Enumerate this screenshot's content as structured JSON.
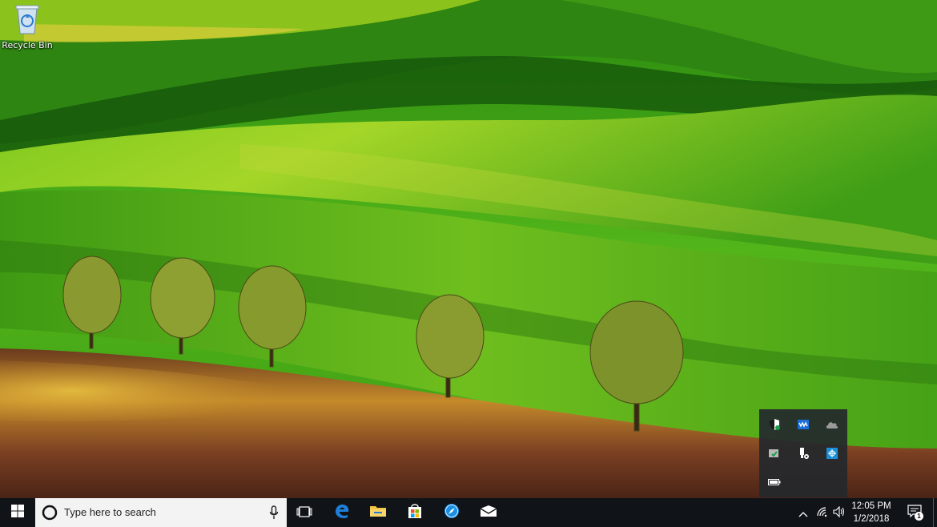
{
  "desktop": {
    "icons": [
      {
        "label": "Recycle Bin",
        "icon": "recycle-bin-icon"
      }
    ]
  },
  "taskbar": {
    "start_icon": "windows-logo-icon",
    "search": {
      "placeholder": "Type here to search",
      "icon": "cortana-icon",
      "mic_icon": "microphone-icon"
    },
    "pinned": [
      {
        "name": "task-view",
        "icon": "task-view-icon"
      },
      {
        "name": "edge",
        "icon": "edge-icon",
        "color": "#1e7fd8"
      },
      {
        "name": "file-explorer",
        "icon": "folder-icon",
        "color": "#f4c542"
      },
      {
        "name": "store",
        "icon": "store-icon"
      },
      {
        "name": "safari",
        "icon": "compass-icon",
        "color": "#1a8fe3"
      },
      {
        "name": "mail",
        "icon": "mail-icon"
      }
    ],
    "tray": {
      "icons": [
        "chevron-up-icon",
        "wifi-icon",
        "volume-icon"
      ],
      "time": "12:05 PM",
      "date": "1/2/2018",
      "notifications_count": "1"
    }
  },
  "tray_flyout": {
    "icons": [
      "shield-icon",
      "waves-app-icon",
      "onedrive-cloud-icon",
      "security-check-icon",
      "usb-safely-remove-icon",
      "network-app-icon",
      "battery-icon"
    ]
  }
}
